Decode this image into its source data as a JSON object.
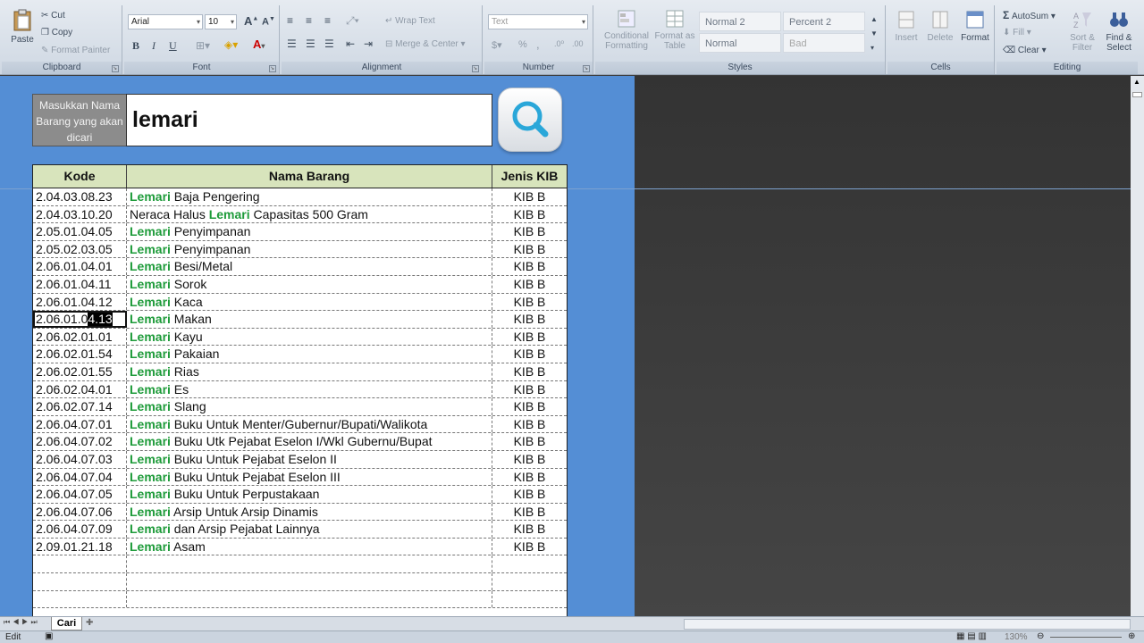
{
  "ribbon": {
    "clipboard": {
      "paste": "Paste",
      "cut": "Cut",
      "copy": "Copy",
      "format_painter": "Format Painter",
      "label": "Clipboard"
    },
    "font": {
      "name": "Arial",
      "size": "10",
      "bold": "B",
      "italic": "I",
      "underline": "U",
      "label": "Font"
    },
    "alignment": {
      "wrap_text": "Wrap Text",
      "merge_center": "Merge & Center",
      "label": "Alignment"
    },
    "number": {
      "format": "Text",
      "percent": "%",
      "comma": ",",
      "label": "Number"
    },
    "styles": {
      "conditional": "Conditional Formatting",
      "format_table": "Format as Table",
      "normal2": "Normal 2",
      "percent2": "Percent 2",
      "normal": "Normal",
      "bad": "Bad",
      "label": "Styles"
    },
    "cells": {
      "insert": "Insert",
      "delete": "Delete",
      "format": "Format",
      "label": "Cells"
    },
    "editing": {
      "autosum": "AutoSum",
      "fill": "Fill",
      "clear": "Clear",
      "sort_filter": "Sort & Filter",
      "find_select": "Find & Select",
      "label": "Editing"
    }
  },
  "search": {
    "label": "Masukkan Nama Barang yang akan dicari",
    "value": "lemari"
  },
  "table": {
    "headers": {
      "kode": "Kode",
      "nama": "Nama Barang",
      "jenis": "Jenis KIB"
    },
    "rows": [
      {
        "kode": "2.04.03.08.23",
        "pre": "",
        "kw": "Lemari",
        "post": " Baja Pengering",
        "jenis": "KIB B"
      },
      {
        "kode": "2.04.03.10.20",
        "pre": "Neraca Halus ",
        "kw": "Lemari",
        "post": " Capasitas 500 Gram",
        "jenis": "KIB B"
      },
      {
        "kode": "2.05.01.04.05",
        "pre": "",
        "kw": "Lemari",
        "post": " Penyimpanan",
        "jenis": "KIB B"
      },
      {
        "kode": "2.05.02.03.05",
        "pre": "",
        "kw": "Lemari",
        "post": " Penyimpanan",
        "jenis": "KIB B"
      },
      {
        "kode": "2.06.01.04.01",
        "pre": "",
        "kw": "Lemari",
        "post": " Besi/Metal",
        "jenis": "KIB B"
      },
      {
        "kode": "2.06.01.04.11",
        "pre": "",
        "kw": "Lemari",
        "post": " Sorok",
        "jenis": "KIB B"
      },
      {
        "kode": "2.06.01.04.12",
        "pre": "",
        "kw": "Lemari",
        "post": " Kaca",
        "jenis": "KIB B"
      },
      {
        "kode": "2.06.01.04.13",
        "pre": "",
        "kw": "Lemari",
        "post": " Makan",
        "jenis": "KIB B"
      },
      {
        "kode": "2.06.02.01.01",
        "pre": "",
        "kw": "Lemari",
        "post": " Kayu",
        "jenis": "KIB B"
      },
      {
        "kode": "2.06.02.01.54",
        "pre": "",
        "kw": "Lemari",
        "post": " Pakaian",
        "jenis": "KIB B"
      },
      {
        "kode": "2.06.02.01.55",
        "pre": "",
        "kw": "Lemari",
        "post": " Rias",
        "jenis": "KIB B"
      },
      {
        "kode": "2.06.02.04.01",
        "pre": "",
        "kw": "Lemari",
        "post": " Es",
        "jenis": "KIB B"
      },
      {
        "kode": "2.06.02.07.14",
        "pre": "",
        "kw": "Lemari",
        "post": " Slang",
        "jenis": "KIB B"
      },
      {
        "kode": "2.06.04.07.01",
        "pre": "",
        "kw": "Lemari",
        "post": " Buku Untuk Menter/Gubernur/Bupati/Walikota",
        "jenis": "KIB B"
      },
      {
        "kode": "2.06.04.07.02",
        "pre": "",
        "kw": "Lemari",
        "post": " Buku Utk Pejabat Eselon I/Wkl Gubernu/Bupat",
        "jenis": "KIB B"
      },
      {
        "kode": "2.06.04.07.03",
        "pre": "",
        "kw": "Lemari",
        "post": " Buku Untuk Pejabat Eselon II",
        "jenis": "KIB B"
      },
      {
        "kode": "2.06.04.07.04",
        "pre": "",
        "kw": "Lemari",
        "post": " Buku Untuk Pejabat Eselon III",
        "jenis": "KIB B"
      },
      {
        "kode": "2.06.04.07.05",
        "pre": "",
        "kw": "Lemari",
        "post": " Buku Untuk Perpustakaan",
        "jenis": "KIB B"
      },
      {
        "kode": "2.06.04.07.06",
        "pre": "",
        "kw": "Lemari",
        "post": " Arsip Untuk Arsip Dinamis",
        "jenis": "KIB B"
      },
      {
        "kode": "2.06.04.07.09",
        "pre": "",
        "kw": "Lemari",
        "post": " dan Arsip Pejabat Lainnya",
        "jenis": "KIB B"
      },
      {
        "kode": "2.09.01.21.18",
        "pre": "",
        "kw": "Lemari",
        "post": " Asam",
        "jenis": "KIB B"
      }
    ],
    "selected_prefix": "2.06.01.0",
    "selected_suffix": "4.13"
  },
  "sheet_tab": "Cari",
  "status": {
    "mode": "Edit",
    "zoom": "130%"
  },
  "colors": {
    "sheet_bg": "#548ed5",
    "header_bg": "#d8e4bc",
    "keyword": "#1e9b3a"
  }
}
